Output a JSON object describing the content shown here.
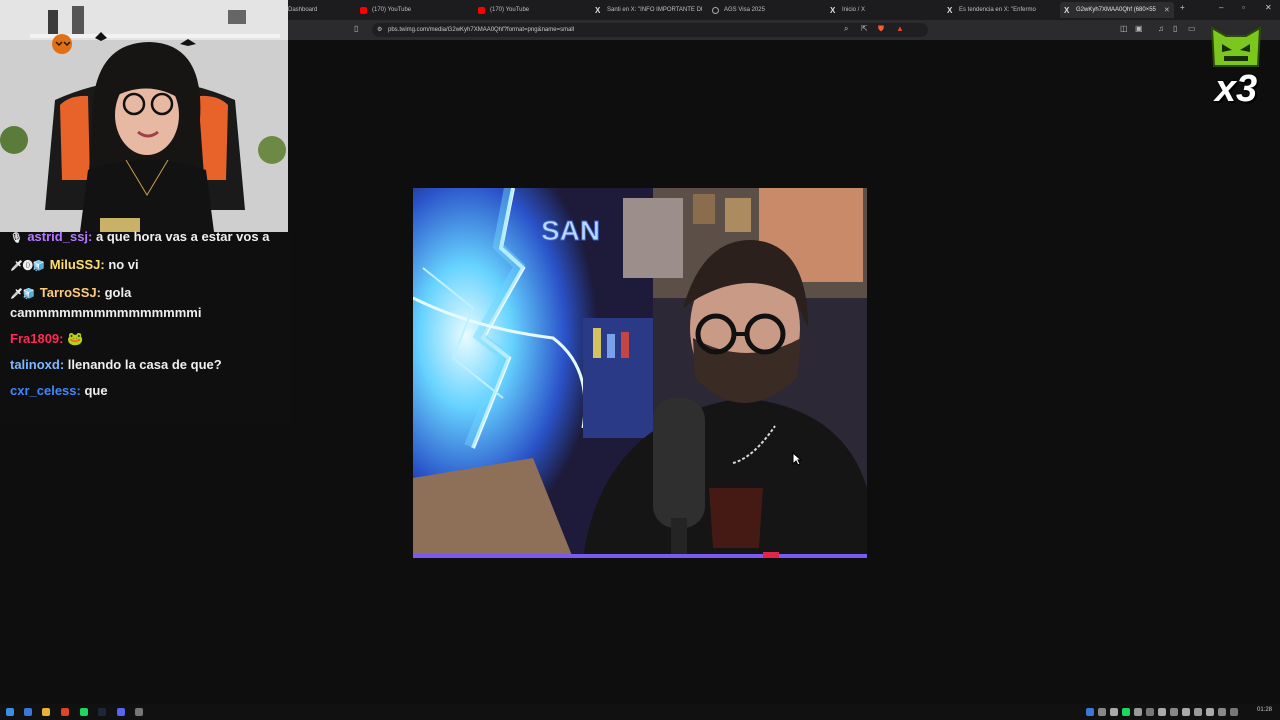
{
  "browser": {
    "tabs": [
      {
        "label": "Dashboard",
        "icon": "dashboard-icon"
      },
      {
        "label": "(170) YouTube",
        "icon": "youtube-icon"
      },
      {
        "label": "(170) YouTube",
        "icon": "youtube-icon"
      },
      {
        "label": "Santi en X: \"INFO IMPORTANTE DI",
        "icon": "x-icon"
      },
      {
        "label": "AGS Visa 2025",
        "icon": "ags-icon"
      },
      {
        "label": "Inicio / X",
        "icon": "x-icon"
      },
      {
        "label": "Es tendencia en X: \"Enfermo",
        "icon": "x-icon"
      },
      {
        "label": "G2wKyh7XMAA0Qhf (680×55",
        "icon": "x-icon"
      }
    ],
    "new_tab": "+",
    "url": "pbs.twimg.com/media/G2wKyh7XMAA0Qhf?format=png&name=small",
    "window_controls": [
      "–",
      "▫",
      "✕"
    ]
  },
  "chat": {
    "messages": [
      {
        "badges": "🎙",
        "user": "astrid_ssj:",
        "text": "a que hora vas a estar vos a"
      },
      {
        "badges": "🗡⓿🧊",
        "user": "MiluSSJ:",
        "text": "no vi"
      },
      {
        "badges": "🗡🧊",
        "user": "TarroSSJ:",
        "text": "gola cammmmmmmmmmmmmmmi"
      },
      {
        "badges": "",
        "user": "Fra1809:",
        "text": "🐸"
      },
      {
        "badges": "",
        "user": "talinoxd:",
        "text": "llenando la casa de que?"
      },
      {
        "badges": "",
        "user": "cxr_celess:",
        "text": "que"
      }
    ]
  },
  "image_viewer": {
    "sign_text": "SAN"
  },
  "overlay": {
    "multiplier": "x3"
  },
  "taskbar": {
    "clock": "01:28"
  },
  "colors": {
    "page_bg": "#0e0e0e",
    "tabbar": "#1c1c1e",
    "addrbar": "#2b2b2d",
    "lightning": "#6fd8ff",
    "overlay_green": "#7cc71f"
  }
}
